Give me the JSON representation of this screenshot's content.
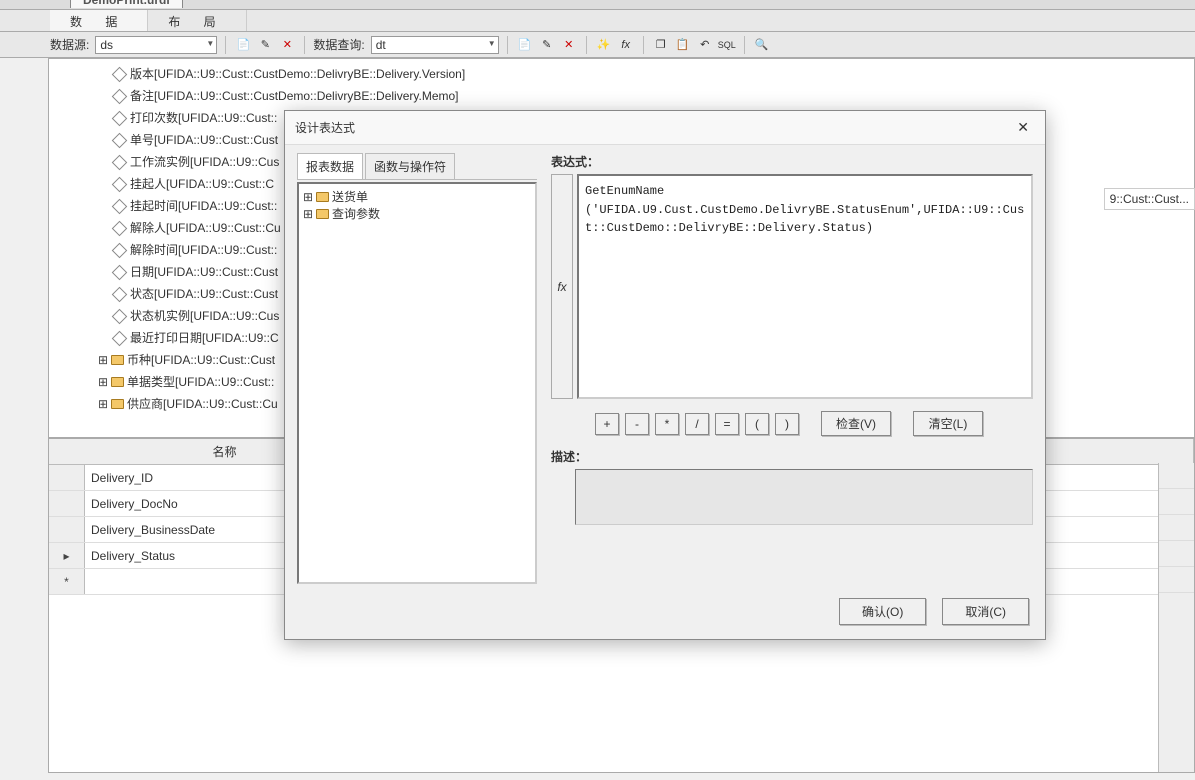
{
  "file_tab": "DemoPrint.urdl",
  "main_tabs": {
    "data": "数  据",
    "layout": "布  局"
  },
  "toolbar": {
    "ds_label": "数据源:",
    "ds_value": "ds",
    "dq_label": "数据查询:",
    "dq_value": "dt"
  },
  "tree": {
    "items": [
      {
        "text": "版本[UFIDA::U9::Cust::CustDemo::DelivryBE::Delivery.Version]",
        "icon": "diamond",
        "indent": 56
      },
      {
        "text": "备注[UFIDA::U9::Cust::CustDemo::DelivryBE::Delivery.Memo]",
        "icon": "diamond",
        "indent": 56
      },
      {
        "text": "打印次数[UFIDA::U9::Cust::",
        "icon": "diamond",
        "indent": 56
      },
      {
        "text": "单号[UFIDA::U9::Cust::Cust",
        "icon": "diamond",
        "indent": 56
      },
      {
        "text": "工作流实例[UFIDA::U9::Cus",
        "icon": "diamond",
        "indent": 56
      },
      {
        "text": "挂起人[UFIDA::U9::Cust::C",
        "icon": "diamond",
        "indent": 56
      },
      {
        "text": "挂起时间[UFIDA::U9::Cust::",
        "icon": "diamond",
        "indent": 56
      },
      {
        "text": "解除人[UFIDA::U9::Cust::Cu",
        "icon": "diamond",
        "indent": 56
      },
      {
        "text": "解除时间[UFIDA::U9::Cust::",
        "icon": "diamond",
        "indent": 56
      },
      {
        "text": "日期[UFIDA::U9::Cust::Cust",
        "icon": "diamond",
        "indent": 56
      },
      {
        "text": "状态[UFIDA::U9::Cust::Cust",
        "icon": "diamond",
        "indent": 56
      },
      {
        "text": "状态机实例[UFIDA::U9::Cus",
        "icon": "diamond",
        "indent": 56
      },
      {
        "text": "最近打印日期[UFIDA::U9::C",
        "icon": "diamond",
        "indent": 56
      },
      {
        "text": "币种[UFIDA::U9::Cust::Cust",
        "icon": "folder",
        "indent": 40,
        "expander": "+"
      },
      {
        "text": "单据类型[UFIDA::U9::Cust::",
        "icon": "folder",
        "indent": 40,
        "expander": "+"
      },
      {
        "text": "供应商[UFIDA::U9::Cust::Cu",
        "icon": "folder",
        "indent": 40,
        "expander": "+"
      }
    ]
  },
  "grid": {
    "header_name": "名称",
    "rows": [
      "Delivery_ID",
      "Delivery_DocNo",
      "Delivery_BusinessDate",
      "Delivery_Status"
    ],
    "truncated_right": "9::Cust::Cust..."
  },
  "dialog": {
    "title": "设计表达式",
    "tabs": {
      "data": "报表数据",
      "func": "函数与操作符"
    },
    "tree": {
      "item1": "送货单",
      "item2": "查询参数"
    },
    "expr_label": "表达式：",
    "expr_text": "GetEnumName\n('UFIDA.U9.Cust.CustDemo.DelivryBE.StatusEnum',UFIDA::U9::Cust::CustDemo::DelivryBE::Delivery.Status)",
    "fx": "fx",
    "ops": {
      "plus": "+",
      "minus": "-",
      "mul": "*",
      "div": "/",
      "eq": "=",
      "lpar": "(",
      "rpar": ")"
    },
    "check": "检查(V)",
    "clear": "清空(L)",
    "desc_label": "描述：",
    "ok": "确认(O)",
    "cancel": "取消(C)"
  }
}
